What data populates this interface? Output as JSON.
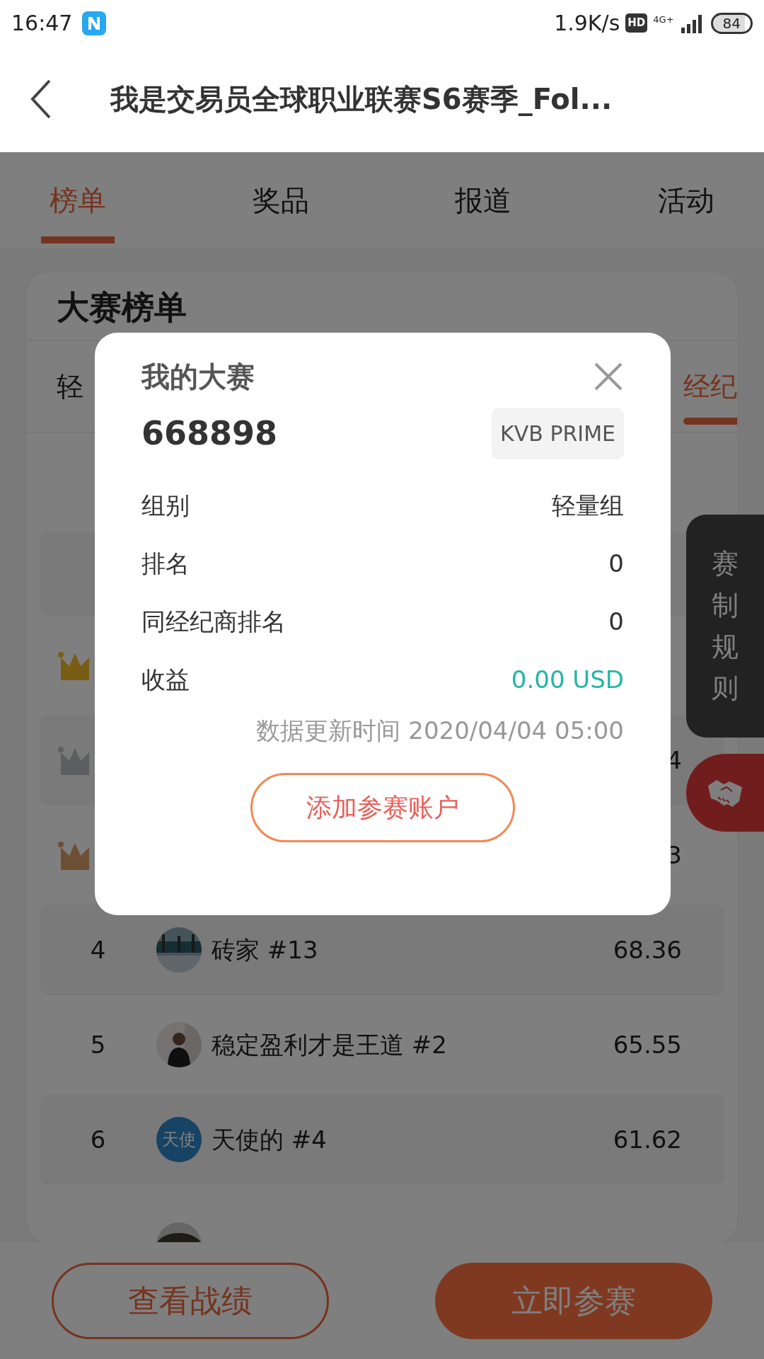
{
  "status_bar": {
    "time": "16:47",
    "speed": "1.9K/s",
    "hd": "HD",
    "network": "4G+",
    "battery": "84"
  },
  "app_bar": {
    "title": "我是交易员全球职业联赛S6赛季_Fol..."
  },
  "tabs": [
    {
      "label": "榜单",
      "selected": true
    },
    {
      "label": "奖品",
      "selected": false
    },
    {
      "label": "报道",
      "selected": false
    },
    {
      "label": "活动",
      "selected": false
    }
  ],
  "board": {
    "title": "大赛榜单",
    "sub_tabs": [
      {
        "label": "轻",
        "selected": false
      },
      {
        "label": "经纪",
        "selected": true
      }
    ],
    "rows": [
      {
        "kind": "crown",
        "color": "#7a5d14",
        "score": ""
      },
      {
        "kind": "crown",
        "color": "#5c5e62",
        "score": "4"
      },
      {
        "kind": "crown",
        "color": "#6d5033",
        "score": "3"
      },
      {
        "kind": "entry",
        "rank": "4",
        "name": "砖家 #13",
        "score": "68.36"
      },
      {
        "kind": "entry",
        "rank": "5",
        "name": "稳定盈利才是王道 #2",
        "score": "65.55"
      },
      {
        "kind": "entry",
        "rank": "6",
        "avatar": {
          "kind": "text",
          "text": "天使"
        },
        "name": "天使的 #4",
        "score": "61.62"
      },
      {
        "kind": "partial"
      }
    ]
  },
  "side": {
    "rules": "赛制规则"
  },
  "bottom_buttons": [
    {
      "label": "查看战绩",
      "kind": "outline"
    },
    {
      "label": "立即参赛",
      "kind": "filled"
    }
  ],
  "modal": {
    "title": "我的大赛",
    "account": "668898",
    "broker": "KVB PRIME",
    "fields": [
      {
        "label": "组别",
        "value": "轻量组",
        "highlight": false
      },
      {
        "label": "排名",
        "value": "0",
        "highlight": false
      },
      {
        "label": "同经纪商排名",
        "value": "0",
        "highlight": false
      },
      {
        "label": "收益",
        "value": "0.00 USD",
        "highlight": true
      }
    ],
    "update_time": "数据更新时间 2020/04/04 05:00",
    "button": "添加参赛账户"
  }
}
